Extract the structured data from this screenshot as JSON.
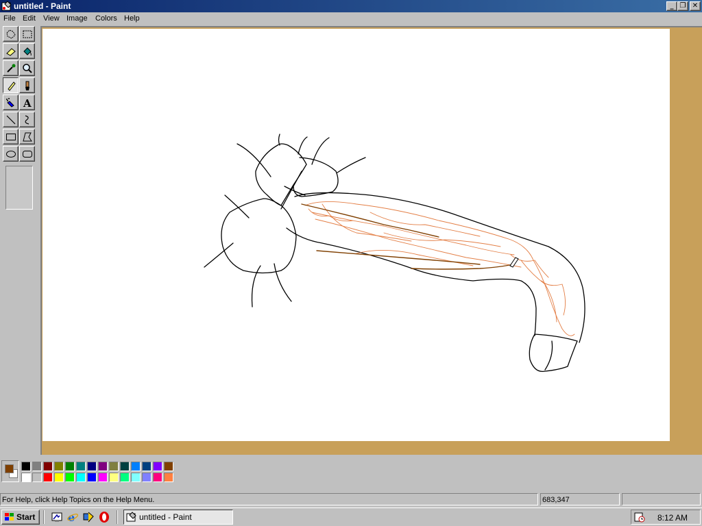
{
  "window": {
    "title": "untitled - Paint"
  },
  "menu": {
    "items": [
      "File",
      "Edit",
      "View",
      "Image",
      "Colors",
      "Help"
    ]
  },
  "tools": [
    {
      "name": "free-form-select",
      "icon": "free-select-icon"
    },
    {
      "name": "select",
      "icon": "rect-select-icon"
    },
    {
      "name": "eraser",
      "icon": "eraser-icon"
    },
    {
      "name": "fill",
      "icon": "fill-bucket-icon"
    },
    {
      "name": "pick-color",
      "icon": "eyedropper-icon"
    },
    {
      "name": "magnifier",
      "icon": "magnifier-icon"
    },
    {
      "name": "pencil",
      "icon": "pencil-icon",
      "active": true
    },
    {
      "name": "brush",
      "icon": "brush-icon"
    },
    {
      "name": "airbrush",
      "icon": "airbrush-icon"
    },
    {
      "name": "text",
      "icon": "text-icon",
      "glyph": "A"
    },
    {
      "name": "line",
      "icon": "line-icon"
    },
    {
      "name": "curve",
      "icon": "curve-icon"
    },
    {
      "name": "rectangle",
      "icon": "rectangle-icon"
    },
    {
      "name": "polygon",
      "icon": "polygon-icon"
    },
    {
      "name": "ellipse",
      "icon": "ellipse-icon"
    },
    {
      "name": "rounded-rectangle",
      "icon": "rounded-rect-icon"
    }
  ],
  "colors": {
    "foreground": "#7f3f00",
    "background": "#ffffff",
    "palette_top": [
      "#000000",
      "#808080",
      "#800000",
      "#808000",
      "#008000",
      "#008080",
      "#000080",
      "#800080",
      "#808040",
      "#004040",
      "#0080ff",
      "#004080",
      "#8000ff",
      "#804000"
    ],
    "palette_bottom": [
      "#ffffff",
      "#c0c0c0",
      "#ff0000",
      "#ffff00",
      "#00ff00",
      "#00ffff",
      "#0000ff",
      "#ff00ff",
      "#ffff80",
      "#00ff80",
      "#80ffff",
      "#8080ff",
      "#ff0080",
      "#ff8040"
    ],
    "workspace": "#c8a05a",
    "stroke_black": "#000000",
    "stroke_orange": "#e07030",
    "stroke_brown": "#7f3f00"
  },
  "status": {
    "help_text": "For Help, click Help Topics on the Help Menu.",
    "coords": "683,347"
  },
  "taskbar": {
    "start_label": "Start",
    "quick_launch": [
      "desktop-icon",
      "ie-icon",
      "channels-icon",
      "opera-icon"
    ],
    "task_label": "untitled - Paint",
    "clock": "8:12 AM"
  }
}
